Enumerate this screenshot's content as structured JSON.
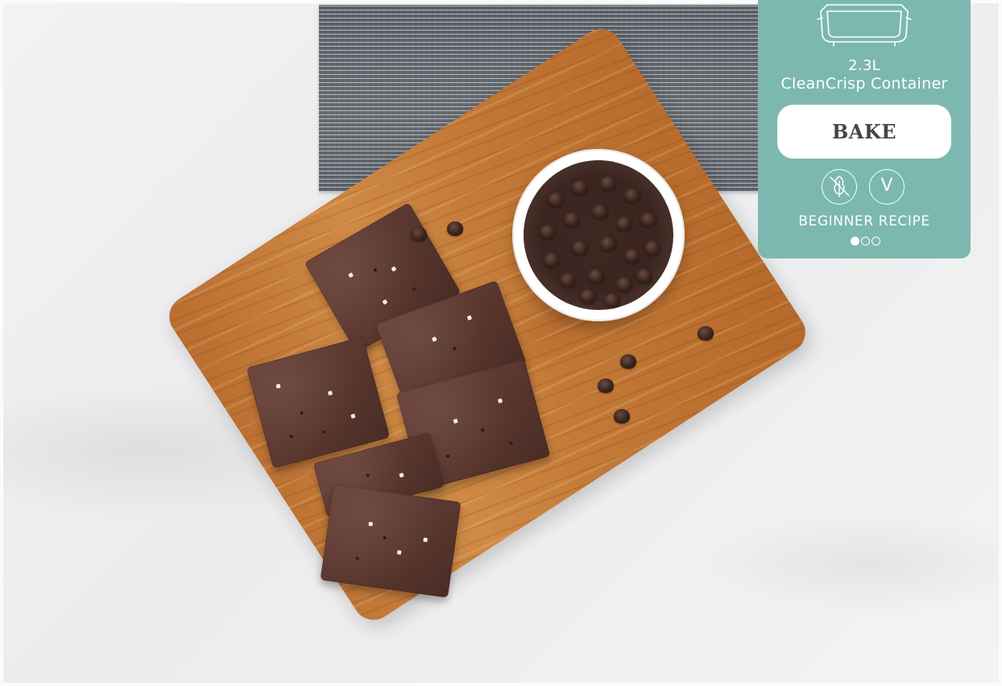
{
  "recipe_card": {
    "capacity": "2.3L",
    "container_name": "CleanCrisp Container",
    "cooking_function": "BAKE",
    "dietary_badges": [
      {
        "icon": "gluten-free-icon"
      },
      {
        "icon": "vegetarian-icon",
        "text": "V"
      }
    ],
    "difficulty_label": "BEGINNER RECIPE",
    "difficulty_level": 1,
    "difficulty_max": 3,
    "card_color": "#7cb8b0"
  },
  "photo": {
    "subject": "chocolate-shortbread-bars",
    "colors": {
      "board": "#c27836",
      "brownie": "#5a372f",
      "towel": "#62666d",
      "counter": "#f0f0f1"
    }
  }
}
